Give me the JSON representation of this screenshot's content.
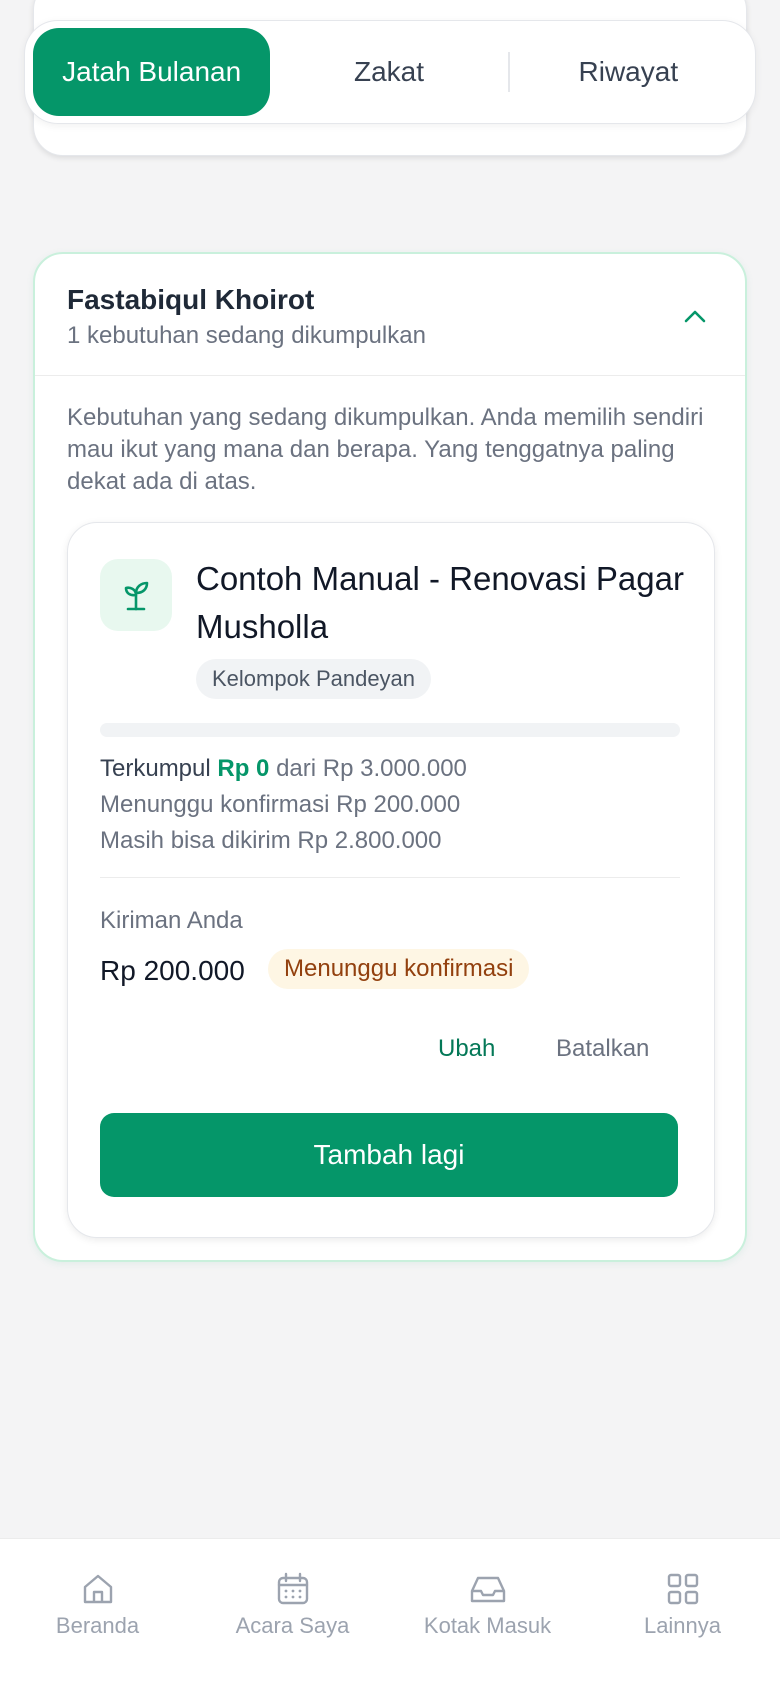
{
  "tabs": [
    {
      "label": "Jatah Bulanan",
      "active": true
    },
    {
      "label": "Zakat",
      "active": false
    },
    {
      "label": "Riwayat",
      "active": false
    }
  ],
  "group": {
    "title": "Fastabiqul Khoirot",
    "subtitle": "1 kebutuhan sedang dikumpulkan",
    "description": "Kebutuhan yang sedang dikumpulkan. Anda memilih sendiri mau ikut yang mana dan berapa. Yang tenggatnya paling dekat ada di atas."
  },
  "need": {
    "icon": "sprout-icon",
    "title": "Contoh Manual - Renovasi Pagar Musholla",
    "group_badge": "Kelompok Pandeyan",
    "progress_fraction": 0,
    "collected_prefix": "Terkumpul",
    "collected_amount": "Rp 0",
    "collected_suffix": "dari Rp 3.000.000",
    "pending_line": "Menunggu konfirmasi Rp 200.000",
    "remaining_line": "Masih bisa dikirim Rp 2.800.000",
    "contribution_label": "Kiriman Anda",
    "contribution_amount": "Rp 200.000",
    "contribution_status": "Menunggu konfirmasi",
    "edit_label": "Ubah",
    "cancel_label": "Batalkan",
    "add_button_label": "Tambah lagi"
  },
  "bottom_nav": [
    {
      "label": "Beranda",
      "icon": "home-icon"
    },
    {
      "label": "Acara Saya",
      "icon": "calendar-icon"
    },
    {
      "label": "Kotak Masuk",
      "icon": "inbox-icon"
    },
    {
      "label": "Lainnya",
      "icon": "grid-icon"
    }
  ],
  "colors": {
    "primary": "#059669",
    "status_bg": "#fef6e4",
    "status_text": "#92400e"
  }
}
